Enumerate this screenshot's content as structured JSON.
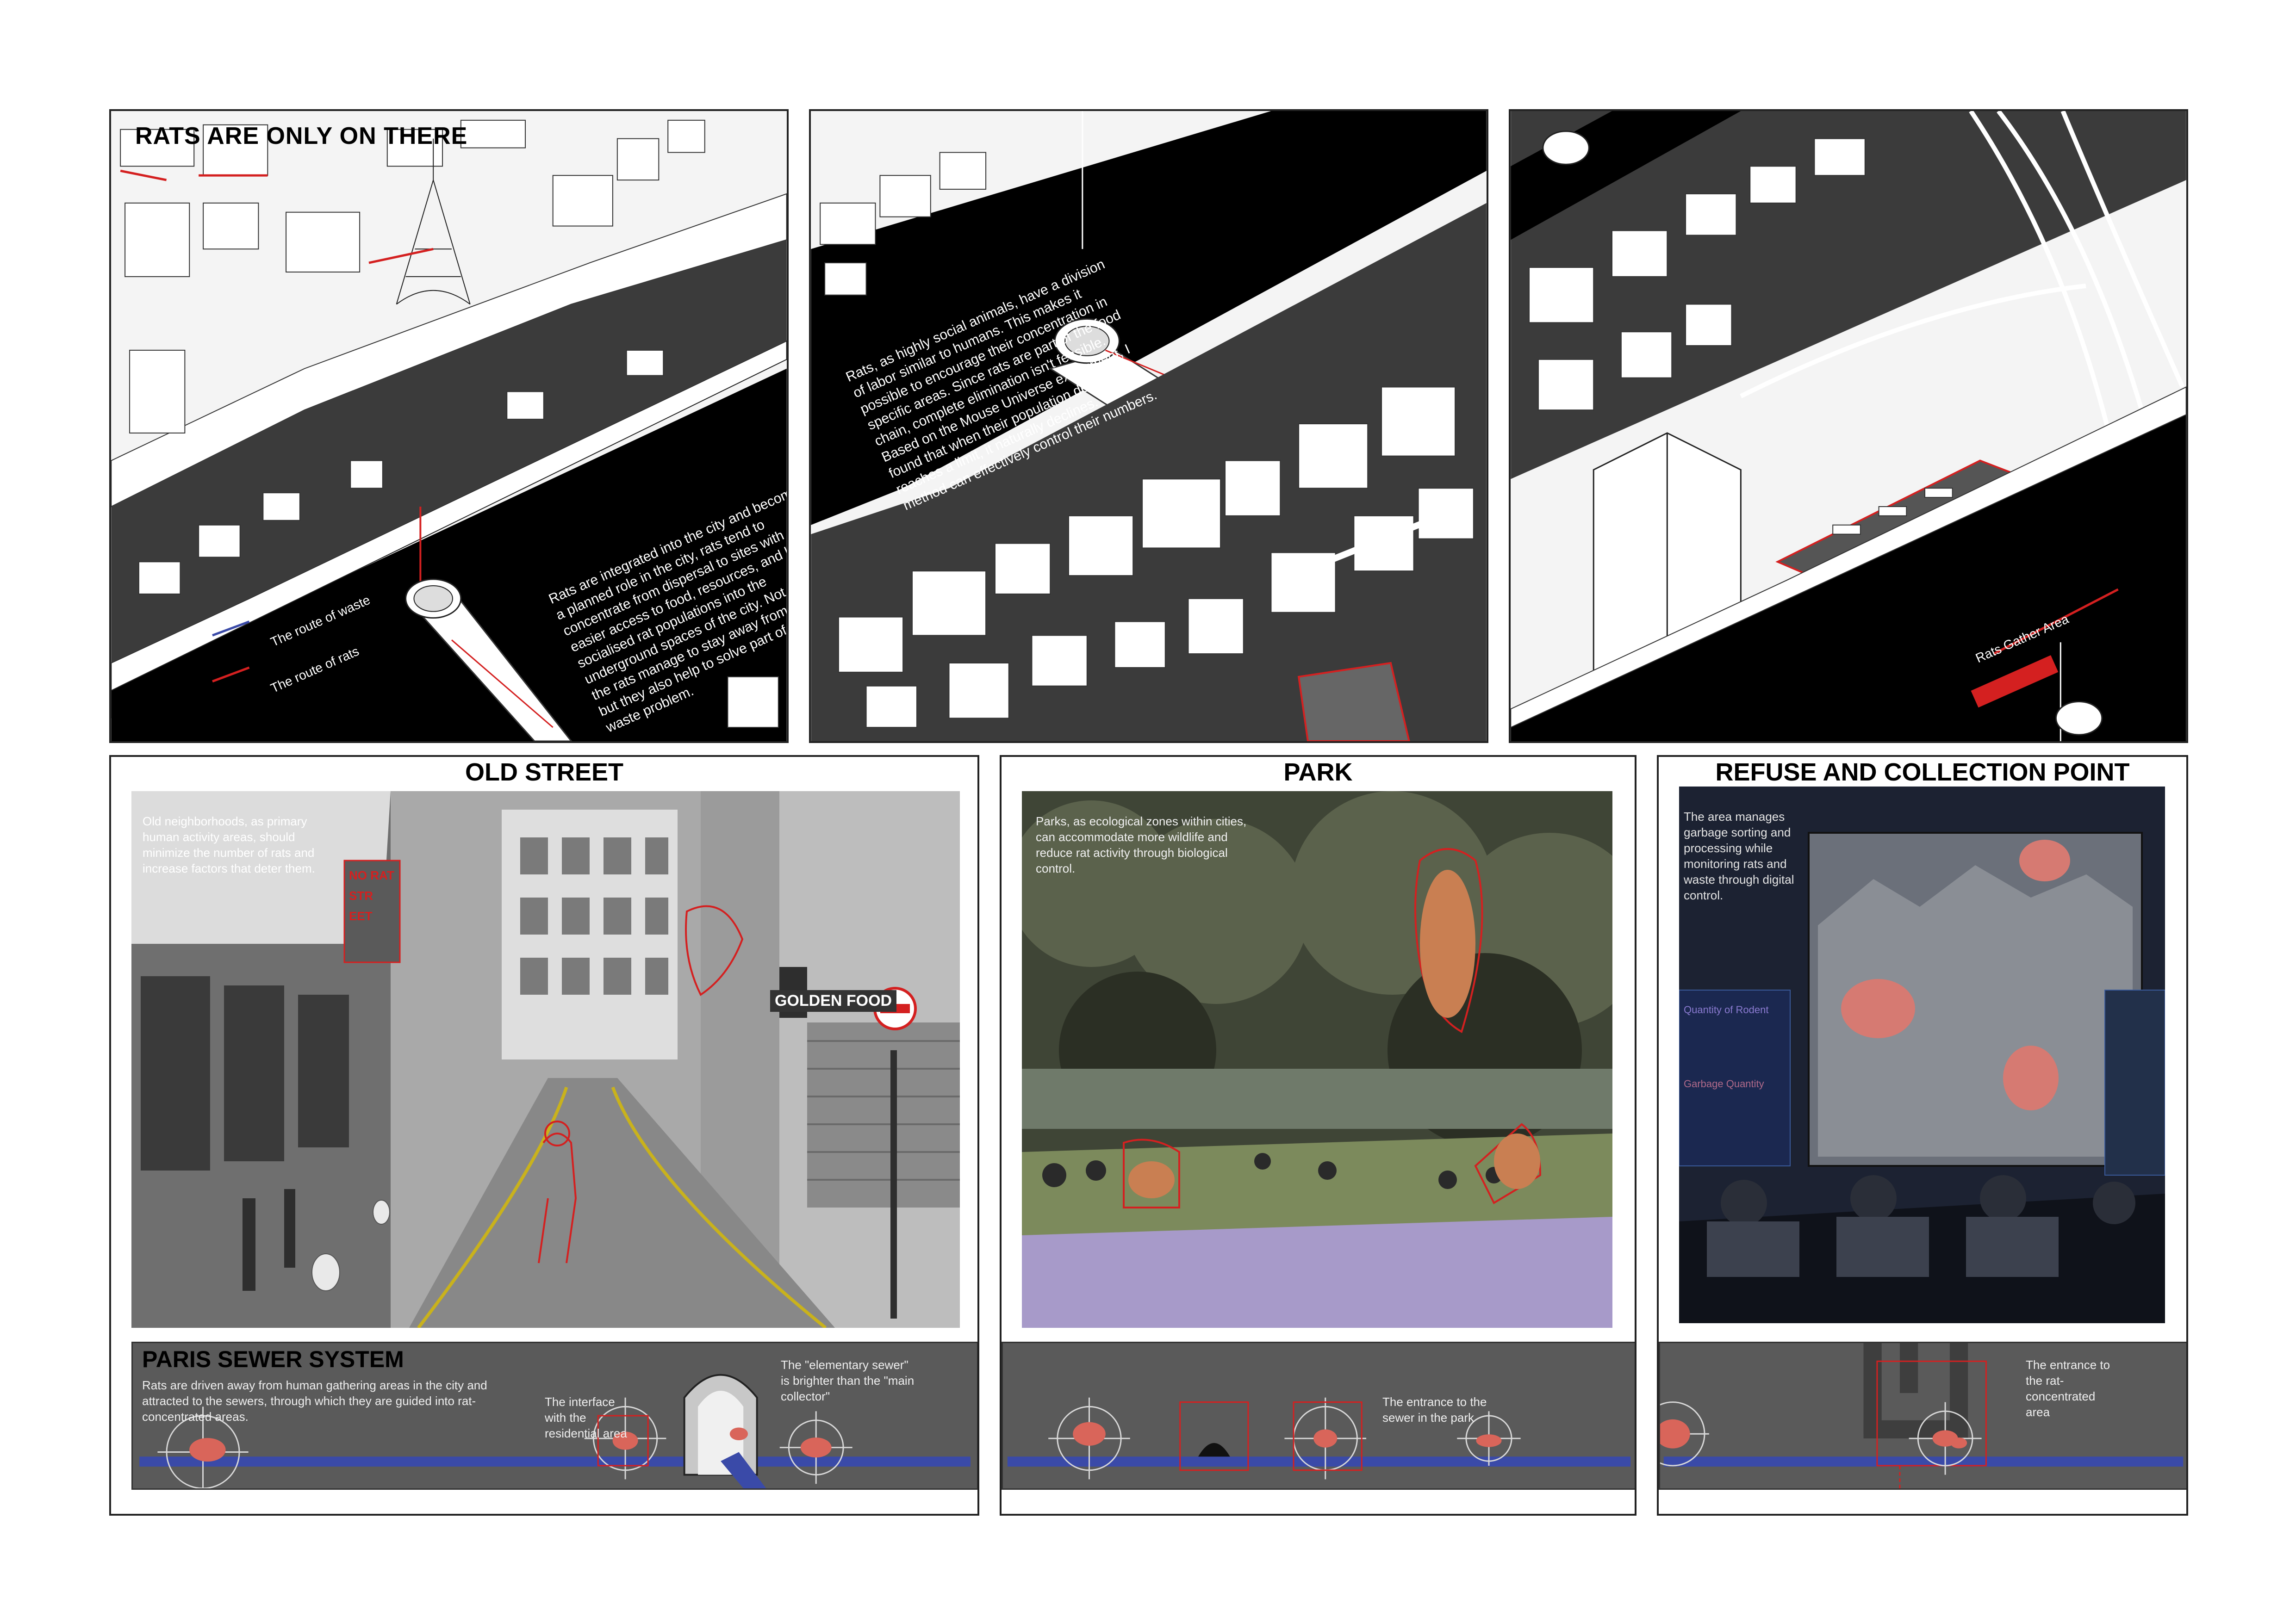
{
  "axo_panels": {
    "rats_only": {
      "title": "RATS ARE ONLY ON THERE",
      "text": "Rats are integrated into the city and become a planned role in the city, rats tend to concentrate from dispersal to sites with easier access to food, resources, and highly socialised rat populations into the underground spaces of the city. Not only do the rats manage to stay away from humans, but they also help to solve part of the human waste problem.",
      "legend_waste": "The route of waste",
      "legend_rats": "The route of rats"
    },
    "social": {
      "text": "Rats, as highly social animals, have a division of labor similar to humans. This makes it possible to encourage their concentration in specific areas. Since rats are part of the food chain, complete elimination isn't feasible. Based on the Mouse Universe experiment, I found that when their population density reaches a limit, it naturally declines. This method can effectively control their numbers."
    },
    "gather": {
      "label": "Rats Gather Area"
    }
  },
  "old_street": {
    "title": "OLD STREET",
    "caption": "Old neighborhoods, as primary human activity areas, should minimize the number of rats and increase factors that deter them.",
    "sign_text": "NO RAT STR EET",
    "shop_sign": "GOLDEN FOOD"
  },
  "park": {
    "title": "PARK",
    "caption": "Parks, as ecological zones within cities, can accommodate more wildlife and reduce rat activity through biological control."
  },
  "refuse": {
    "title": "REFUSE AND COLLECTION POINT",
    "caption": "The area manages garbage sorting and processing while monitoring rats and waste through digital control.",
    "screen_labels": [
      "Quantity of Rodent",
      "Garbage Quantity"
    ]
  },
  "sewer": {
    "title": "PARIS SEWER SYSTEM",
    "intro": "Rats are driven away from human gathering areas in the city and attracted to the sewers, through which they are guided into rat-concentrated areas.",
    "interface": "The interface with the residential area",
    "elementary": "The \"elementary sewer\" is brighter than the \"main collector\"",
    "park_entrance": "The entrance to the sewer in the park",
    "rat_area_entrance": "The entrance to the rat-concentrated area"
  },
  "colors": {
    "accent_red": "#d42020",
    "route_blue": "#3a4aa8",
    "dark_ground": "#000000",
    "strip_grey": "#5a5a5a"
  }
}
